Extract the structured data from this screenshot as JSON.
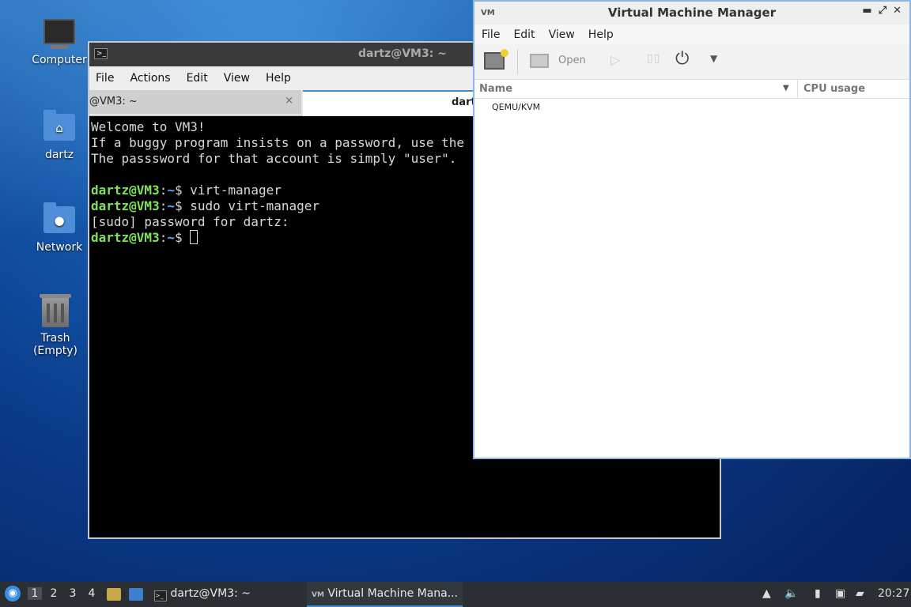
{
  "desktop": {
    "icons": [
      {
        "label": "Computer",
        "icon": "monitor-icon"
      },
      {
        "label": "dartz",
        "icon": "home-folder-icon"
      },
      {
        "label": "Network",
        "icon": "network-folder-icon"
      },
      {
        "label": "Trash (Empty)",
        "icon": "trash-icon"
      }
    ]
  },
  "terminal": {
    "title": "dartz@VM3: ~",
    "menu": [
      "File",
      "Actions",
      "Edit",
      "View",
      "Help"
    ],
    "tabs": [
      {
        "label": "@VM3: ~",
        "close": "×"
      },
      {
        "label": "dartz"
      }
    ],
    "lines": {
      "l1": "Welcome to VM3!",
      "l2": "If a buggy program insists on a password, use the",
      "l3": "The passsword for that account is simply \"user\".",
      "p_user": "dartz@VM3",
      "p_sep": ":",
      "p_path": "~",
      "p_dollar": "$ ",
      "c1": "virt-manager",
      "c2": "sudo virt-manager",
      "l6": "[sudo] password for dartz:"
    }
  },
  "vmm": {
    "title": "Virtual Machine Manager",
    "menu": [
      "File",
      "Edit",
      "View",
      "Help"
    ],
    "toolbar": {
      "open_label": "Open"
    },
    "columns": {
      "name": "Name",
      "cpu": "CPU usage"
    },
    "rows": [
      "QEMU/KVM"
    ]
  },
  "taskbar": {
    "workspaces": [
      "1",
      "2",
      "3",
      "4"
    ],
    "tasks": {
      "terminal": "dartz@VM3: ~",
      "vmm": "Virtual Machine Mana..."
    },
    "clock": "20:27"
  }
}
